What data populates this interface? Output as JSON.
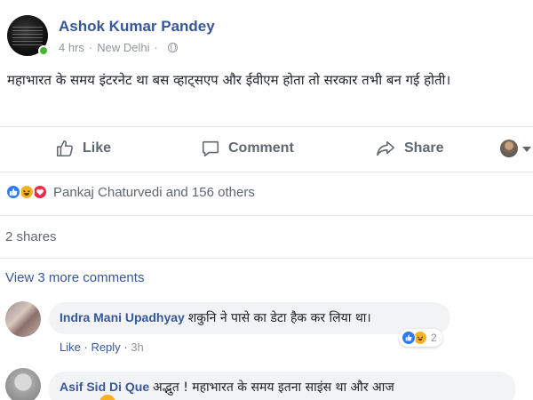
{
  "post": {
    "author": "Ashok Kumar Pandey",
    "time": "4 hrs",
    "location": "New Delhi",
    "text": "महाभारत के समय इंटरनेट था बस व्हाट्सएप और ईवीएम होता तो सरकार तभी बन गई होती।"
  },
  "actions": {
    "like": "Like",
    "comment": "Comment",
    "share": "Share"
  },
  "reactions": {
    "summary": "Pankaj Chaturvedi and 156 others",
    "types": [
      "like",
      "haha",
      "love"
    ]
  },
  "shares": "2 shares",
  "view_more": "View 3 more comments",
  "comments": [
    {
      "name": "Indra Mani Upadhyay",
      "text": "शकुनि ने पासे का डेटा हैक कर लिया था।",
      "like_label": "Like",
      "reply_label": "Reply",
      "time": "3h",
      "reaction_count": "2",
      "reaction_types": [
        "like",
        "haha"
      ]
    },
    {
      "name": "Asif Sid Di Que",
      "text": "अद्भुत ! महाभारत के समय इतना साइंस था और आज"
    }
  ],
  "colors": {
    "link_blue": "#365899",
    "like_blue": "#2f7bf5",
    "haha_yellow": "#f7b125",
    "love_red": "#f0284a",
    "online_green": "#42b72a"
  }
}
